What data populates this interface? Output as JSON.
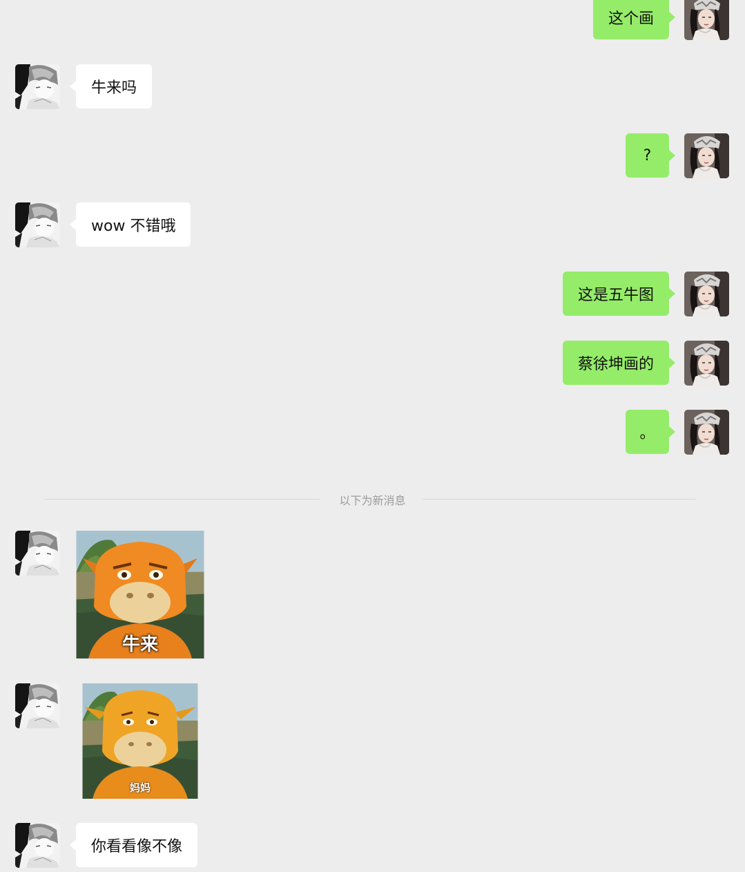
{
  "messages": [
    {
      "side": "out",
      "text": "这个画"
    },
    {
      "side": "in",
      "text": "牛来吗"
    },
    {
      "side": "out",
      "text": "?"
    },
    {
      "side": "in",
      "text": "wow 不错哦"
    },
    {
      "side": "out",
      "text": "这是五牛图"
    },
    {
      "side": "out",
      "text": "蔡徐坤画的"
    },
    {
      "side": "out",
      "text": "。"
    },
    {
      "side": "in",
      "type": "sticker",
      "caption": "牛来"
    },
    {
      "side": "in",
      "type": "sticker",
      "caption": "妈妈"
    },
    {
      "side": "in",
      "text": "你看看像不像"
    }
  ],
  "divider": {
    "text": "以下为新消息"
  },
  "colors": {
    "background": "#ededed",
    "outgoing_bubble": "#95ec69",
    "incoming_bubble": "#ffffff",
    "divider_text": "#9b9b9b"
  },
  "icons": {
    "contact_avatar": "monochrome-anime-avatar",
    "my_avatar": "girl-photo-avatar"
  }
}
